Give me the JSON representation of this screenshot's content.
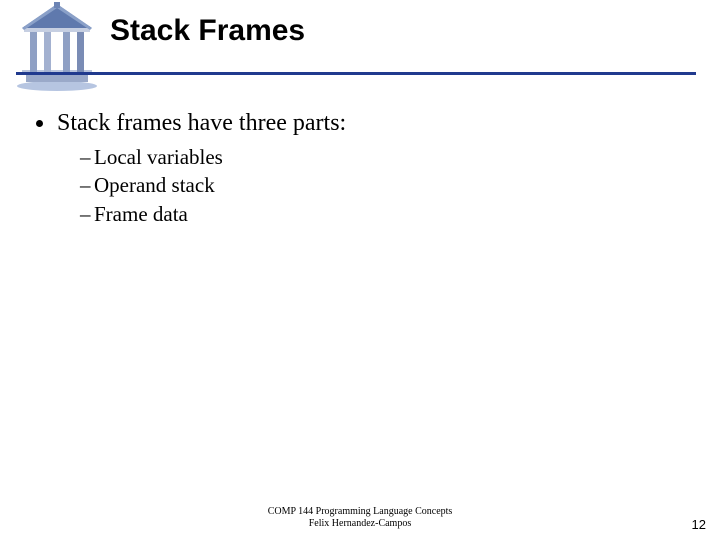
{
  "title": "Stack Frames",
  "bullet": "Stack frames have three parts:",
  "subs": {
    "a": "Local variables",
    "b": "Operand stack",
    "c": "Frame data"
  },
  "footer": {
    "line1": "COMP 144 Programming Language Concepts",
    "line2": "Felix Hernandez-Campos"
  },
  "page": "12"
}
